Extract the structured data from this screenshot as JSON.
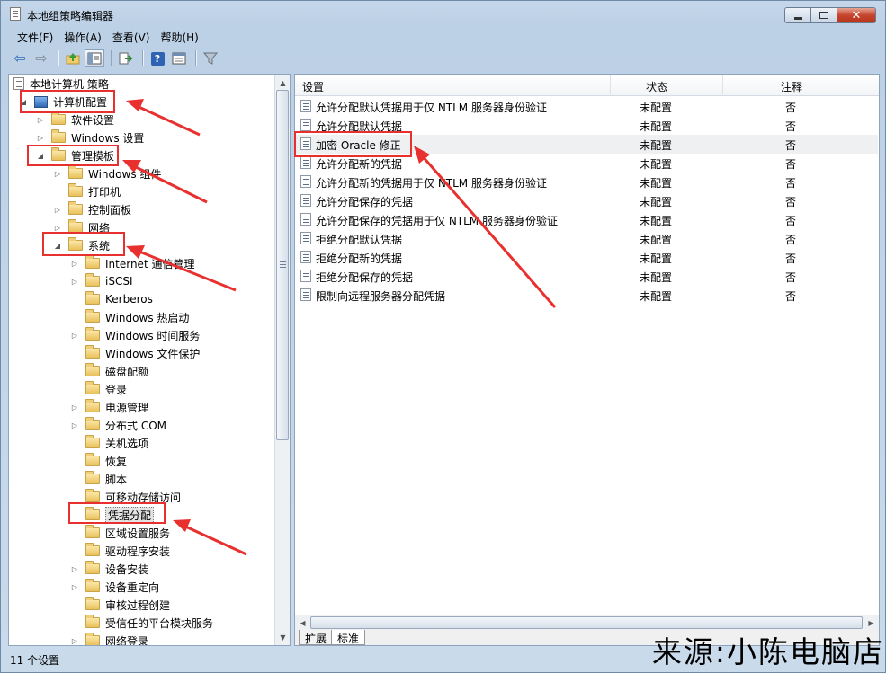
{
  "window": {
    "title": "本地组策略编辑器",
    "controls": {
      "minimize": "–",
      "maximize": "□",
      "close": "✕"
    }
  },
  "menubar": {
    "items": [
      "文件(F)",
      "操作(A)",
      "查看(V)",
      "帮助(H)"
    ]
  },
  "toolbar": {
    "icons": [
      "back-icon",
      "forward-icon",
      "up-folder-icon",
      "show-hide-tree-icon",
      "export-list-icon",
      "help-icon",
      "properties-icon",
      "filter-icon"
    ]
  },
  "tree": {
    "root": "本地计算机 策略",
    "items": [
      {
        "label": "计算机配置",
        "expander": "◢",
        "icon": "computer"
      },
      {
        "label": "软件设置",
        "expander": "▷",
        "icon": "folder"
      },
      {
        "label": "Windows 设置",
        "expander": "▷",
        "icon": "folder"
      },
      {
        "label": "管理模板",
        "expander": "◢",
        "icon": "folder"
      },
      {
        "label": "Windows 组件",
        "expander": "▷",
        "icon": "folder"
      },
      {
        "label": "打印机",
        "expander": "",
        "icon": "folder"
      },
      {
        "label": "控制面板",
        "expander": "▷",
        "icon": "folder"
      },
      {
        "label": "网络",
        "expander": "▷",
        "icon": "folder"
      },
      {
        "label": "系统",
        "expander": "◢",
        "icon": "folder"
      },
      {
        "label": "Internet 通信管理",
        "expander": "▷",
        "icon": "folder"
      },
      {
        "label": "iSCSI",
        "expander": "▷",
        "icon": "folder"
      },
      {
        "label": "Kerberos",
        "expander": "",
        "icon": "folder"
      },
      {
        "label": "Windows 热启动",
        "expander": "",
        "icon": "folder"
      },
      {
        "label": "Windows 时间服务",
        "expander": "▷",
        "icon": "folder"
      },
      {
        "label": "Windows 文件保护",
        "expander": "",
        "icon": "folder"
      },
      {
        "label": "磁盘配额",
        "expander": "",
        "icon": "folder"
      },
      {
        "label": "登录",
        "expander": "",
        "icon": "folder"
      },
      {
        "label": "电源管理",
        "expander": "▷",
        "icon": "folder"
      },
      {
        "label": "分布式 COM",
        "expander": "▷",
        "icon": "folder"
      },
      {
        "label": "关机选项",
        "expander": "",
        "icon": "folder"
      },
      {
        "label": "恢复",
        "expander": "",
        "icon": "folder"
      },
      {
        "label": "脚本",
        "expander": "",
        "icon": "folder"
      },
      {
        "label": "可移动存储访问",
        "expander": "",
        "icon": "folder"
      },
      {
        "label": "凭据分配",
        "expander": "",
        "icon": "folder"
      },
      {
        "label": "区域设置服务",
        "expander": "",
        "icon": "folder"
      },
      {
        "label": "驱动程序安装",
        "expander": "",
        "icon": "folder"
      },
      {
        "label": "设备安装",
        "expander": "▷",
        "icon": "folder"
      },
      {
        "label": "设备重定向",
        "expander": "▷",
        "icon": "folder"
      },
      {
        "label": "审核过程创建",
        "expander": "",
        "icon": "folder"
      },
      {
        "label": "受信任的平台模块服务",
        "expander": "",
        "icon": "folder"
      },
      {
        "label": "网络登录",
        "expander": "▷",
        "icon": "folder"
      }
    ]
  },
  "list": {
    "columns": [
      "设置",
      "状态",
      "注释"
    ],
    "rows": [
      {
        "setting": "允许分配默认凭据用于仅 NTLM 服务器身份验证",
        "state": "未配置",
        "comment": "否"
      },
      {
        "setting": "允许分配默认凭据",
        "state": "未配置",
        "comment": "否"
      },
      {
        "setting": "加密 Oracle 修正",
        "state": "未配置",
        "comment": "否"
      },
      {
        "setting": "允许分配新的凭据",
        "state": "未配置",
        "comment": "否"
      },
      {
        "setting": "允许分配新的凭据用于仅 NTLM 服务器身份验证",
        "state": "未配置",
        "comment": "否"
      },
      {
        "setting": "允许分配保存的凭据",
        "state": "未配置",
        "comment": "否"
      },
      {
        "setting": "允许分配保存的凭据用于仅 NTLM 服务器身份验证",
        "state": "未配置",
        "comment": "否"
      },
      {
        "setting": "拒绝分配默认凭据",
        "state": "未配置",
        "comment": "否"
      },
      {
        "setting": "拒绝分配新的凭据",
        "state": "未配置",
        "comment": "否"
      },
      {
        "setting": "拒绝分配保存的凭据",
        "state": "未配置",
        "comment": "否"
      },
      {
        "setting": "限制向远程服务器分配凭据",
        "state": "未配置",
        "comment": "否"
      }
    ],
    "tabs": [
      "扩展",
      "标准"
    ]
  },
  "status": {
    "text": "11 个设置"
  },
  "watermark": "来源:小陈电脑店",
  "colors": {
    "annotation": "#e8302f"
  }
}
